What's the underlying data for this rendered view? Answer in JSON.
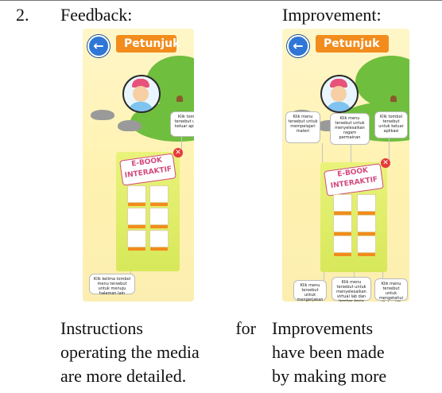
{
  "row_number": "2.",
  "columns": {
    "feedback_header": "Feedback:",
    "improvement_header": "Improvement:"
  },
  "left_screen": {
    "title": "Petunjuk",
    "bubble_top": "Klik tombol tersebut untuk keluar aplikasi",
    "ebook_title": "E-BOOK INTERAKTIF",
    "bubble_bottom": "Klik kelima tombol menu tersebut untuk menuju halaman lain"
  },
  "right_screen": {
    "title": "Petunjuk",
    "bubble_1": "Klik menu tersebut untuk mempelajari materi",
    "bubble_2": "Klik menu tersebut untuk menyelesaikan ragam permainan",
    "bubble_3": "Klik tombol tersebut untuk keluar aplikasi",
    "ebook_title": "E-BOOK INTERAKTIF",
    "bubble_4": "Klik menu tersebut untuk mengerjakan soal kuis",
    "bubble_5": "Klik menu tersebut untuk menyelesaikan virtual lab dan lembar kerja",
    "bubble_6": "Klik menu tersebut untuk mengetahui KI dan KD pembelajaran"
  },
  "captions": {
    "feedback_lines": [
      "Instructions for",
      "operating the media",
      "are more detailed."
    ],
    "improvement_lines": [
      "Improvements",
      "have been made",
      "by making more"
    ]
  },
  "icons": {
    "back": "back-arrow-icon",
    "close": "close-icon"
  }
}
